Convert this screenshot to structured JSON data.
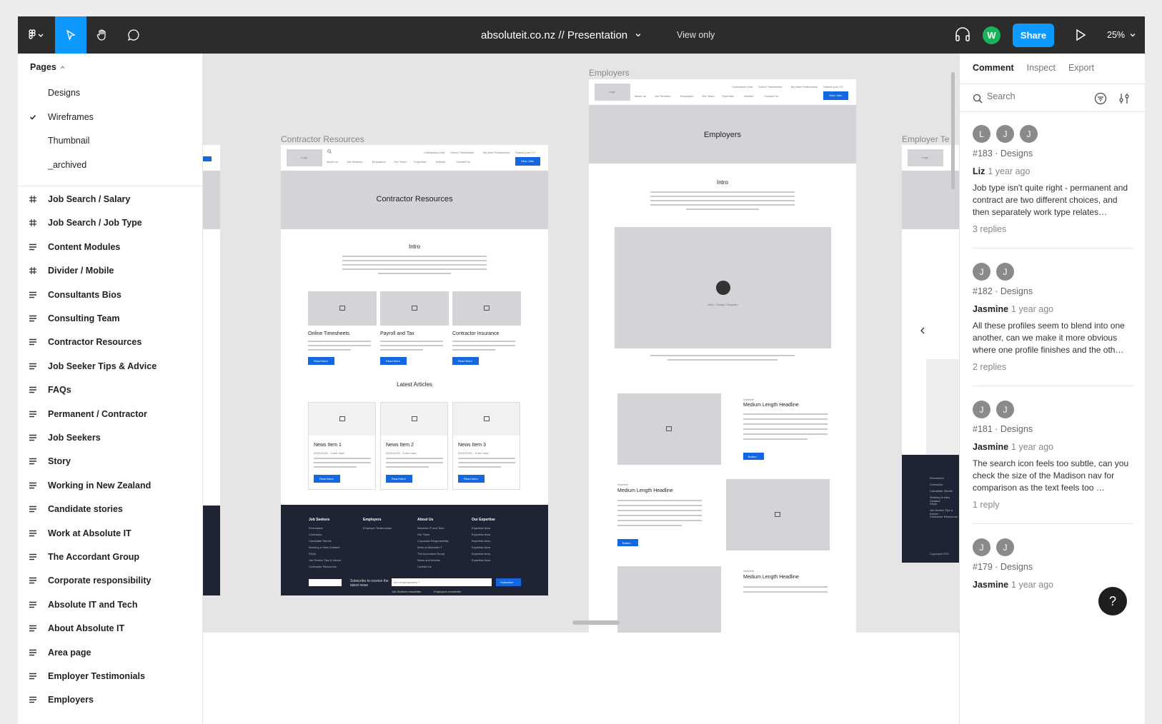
{
  "toolbar": {
    "file_title": "absoluteit.co.nz // Presentation",
    "view_mode": "View only",
    "avatar_initial": "W",
    "share_label": "Share",
    "zoom": "25%"
  },
  "sidebar": {
    "pages_label": "Pages",
    "pages": [
      {
        "label": "Designs",
        "checked": false
      },
      {
        "label": "Wireframes",
        "checked": true
      },
      {
        "label": "Thumbnail",
        "checked": false
      },
      {
        "label": "_archived",
        "checked": false
      }
    ],
    "layers": [
      {
        "label": "Job Search / Salary",
        "icon": "frame-icon"
      },
      {
        "label": "Job Search / Job Type",
        "icon": "frame-icon"
      },
      {
        "label": "Content Modules",
        "icon": "layout-icon"
      },
      {
        "label": "Divider / Mobile",
        "icon": "frame-icon"
      },
      {
        "label": "Consultants Bios",
        "icon": "layout-icon"
      },
      {
        "label": "Consulting Team",
        "icon": "layout-icon"
      },
      {
        "label": "Contractor Resources",
        "icon": "layout-icon"
      },
      {
        "label": "Job Seeker Tips & Advice",
        "icon": "layout-icon"
      },
      {
        "label": "FAQs",
        "icon": "layout-icon"
      },
      {
        "label": "Permanent / Contractor",
        "icon": "layout-icon"
      },
      {
        "label": "Job Seekers",
        "icon": "layout-icon"
      },
      {
        "label": "Story",
        "icon": "layout-icon"
      },
      {
        "label": "Working in New Zealand",
        "icon": "layout-icon"
      },
      {
        "label": "Candidate stories",
        "icon": "layout-icon"
      },
      {
        "label": "Work at Absolute IT",
        "icon": "layout-icon"
      },
      {
        "label": "The Accordant Group",
        "icon": "layout-icon"
      },
      {
        "label": "Corporate responsibility",
        "icon": "layout-icon"
      },
      {
        "label": "Absolute IT and Tech",
        "icon": "layout-icon"
      },
      {
        "label": "About Absolute IT",
        "icon": "layout-icon"
      },
      {
        "label": "Area page",
        "icon": "layout-icon"
      },
      {
        "label": "Employer Testimonials",
        "icon": "layout-icon"
      },
      {
        "label": "Employers",
        "icon": "layout-icon"
      }
    ]
  },
  "canvas": {
    "frames": {
      "contractor": {
        "label": "Contractor Resources",
        "logo": "Logo",
        "nav_top": [
          "Contractors Hub",
          "Online Timesheets",
          "My Alert Preferences",
          "Submit your CV"
        ],
        "nav_main": [
          "About us",
          "Job Seekers",
          "Employers",
          "Our Team",
          "Expertise",
          "Articles",
          "Contact Us"
        ],
        "cta": "View Jobs",
        "hero": "Contractor Resources",
        "intro": "Intro",
        "cards": [
          "Online Timesheets",
          "Payroll and Tax",
          "Contractor Insurance"
        ],
        "card_button": "Read More",
        "articles_title": "Latest Articles",
        "news": [
          "News Item 1",
          "News Item 2",
          "News Item 3"
        ],
        "news_meta": "01/01/2021 - 5 min read",
        "footer_cols": [
          {
            "title": "Job Seekers",
            "links": [
              "Permanent",
              "Contractor",
              "Candidate Stories",
              "Working in New Zealand",
              "FAQs",
              "Job Seeker Tips & Advice",
              "Contractor Resources"
            ]
          },
          {
            "title": "Employers",
            "links": [
              "Employer Testimonials"
            ]
          },
          {
            "title": "About Us",
            "links": [
              "Absolute IT and Tech",
              "Our Team",
              "Corporate Responsibility",
              "Work at Absolute IT",
              "The Accordant Group",
              "News and Articles",
              "Contact Us"
            ]
          },
          {
            "title": "Our Expertise",
            "links": [
              "Expertise Area",
              "Expertise Area",
              "Expertise Area",
              "Expertise Area",
              "Expertise Area",
              "Expertise Area"
            ]
          }
        ],
        "subscribe_text": "Subscribe to receive the latest news",
        "email_placeholder": "Your email address *",
        "subscribe_button": "Subscribe",
        "check1": "Job Seekers newsletter",
        "check2": "Employers newsletter"
      },
      "employers": {
        "label": "Employers",
        "hero": "Employers",
        "intro": "Intro",
        "video_caption": "Video / Image / Diagram",
        "overline": "Overline",
        "headline": "Medium Length Headline",
        "button": "Button"
      },
      "employer_t": {
        "label": "Employer Te",
        "copyright": "Copyright 2021"
      }
    }
  },
  "panel": {
    "tabs": [
      "Comment",
      "Inspect",
      "Export"
    ],
    "search_placeholder": "Search",
    "threads": [
      {
        "avatars": [
          "L",
          "J",
          "J"
        ],
        "ref": "#183 · Designs",
        "author": "Liz",
        "time": "1 year ago",
        "body": "Job type isn't quite right - permanent and contract are two different choices, and then separately work type relates…",
        "replies": "3 replies"
      },
      {
        "avatars": [
          "J",
          "J"
        ],
        "ref": "#182 · Designs",
        "author": "Jasmine",
        "time": "1 year ago",
        "body": "All these profiles seem to blend into one another, can we make it more obvious where one profile finishes and the oth…",
        "replies": "2 replies"
      },
      {
        "avatars": [
          "J",
          "J"
        ],
        "ref": "#181 · Designs",
        "author": "Jasmine",
        "time": "1 year ago",
        "body": "The search icon feels too subtle, can you check the size of the Madison nav for comparison as the text feels too …",
        "replies": "1 reply"
      },
      {
        "avatars": [
          "J",
          "J"
        ],
        "ref": "#179 · Designs",
        "author": "Jasmine",
        "time": "1 year ago",
        "body": "",
        "replies": ""
      }
    ]
  },
  "help_label": "?",
  "colors": {
    "accent": "#0d99ff",
    "toolbar": "#2c2c2c",
    "avatar_green": "#1bb35a",
    "wireframe_blue": "#1367e0",
    "footer_dark": "#1e2433"
  }
}
